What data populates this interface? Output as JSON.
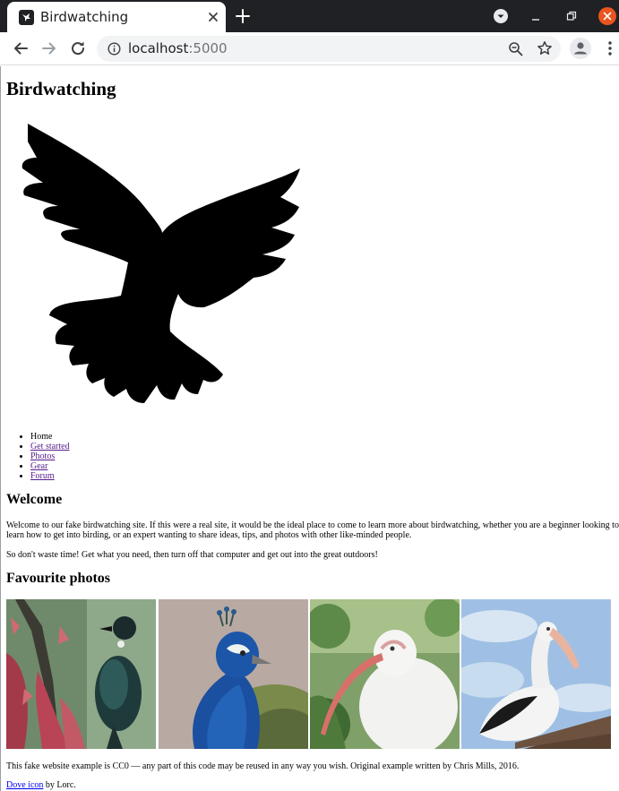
{
  "browser": {
    "tab_title": "Birdwatching",
    "url_host": "localhost",
    "url_port": ":5000"
  },
  "page": {
    "title": "Birdwatching",
    "logo_alt": "dove",
    "nav": [
      {
        "label": "Home",
        "link": false
      },
      {
        "label": "Get started",
        "link": true
      },
      {
        "label": "Photos",
        "link": true
      },
      {
        "label": "Gear",
        "link": true
      },
      {
        "label": "Forum",
        "link": true
      }
    ],
    "welcome_heading": "Welcome",
    "welcome_p1": "Welcome to our fake birdwatching site. If this were a real site, it would be the ideal place to come to learn more about birdwatching, whether you are a beginner looking to learn how to get into birding, or an expert wanting to share ideas, tips, and photos with other like-minded people.",
    "welcome_p2": "So don't waste time! Get what you need, then turn off that computer and get out into the great outdoors!",
    "photos_heading": "Favourite photos",
    "photos": [
      {
        "subject": "tui on red flowers"
      },
      {
        "subject": "peacock"
      },
      {
        "subject": "white ibis"
      },
      {
        "subject": "pelican"
      }
    ],
    "footer_license": "This fake website example is CC0 — any part of this code may be reused in any way you wish. Original example written by Chris Mills, 2016.",
    "footer_credit_link": "Dove icon",
    "footer_credit_rest": " by Lorc."
  },
  "colors": {
    "tab_strip": "#202124",
    "close_button": "#e95420",
    "visited_link": "#551a8b",
    "link": "#0000ee"
  }
}
